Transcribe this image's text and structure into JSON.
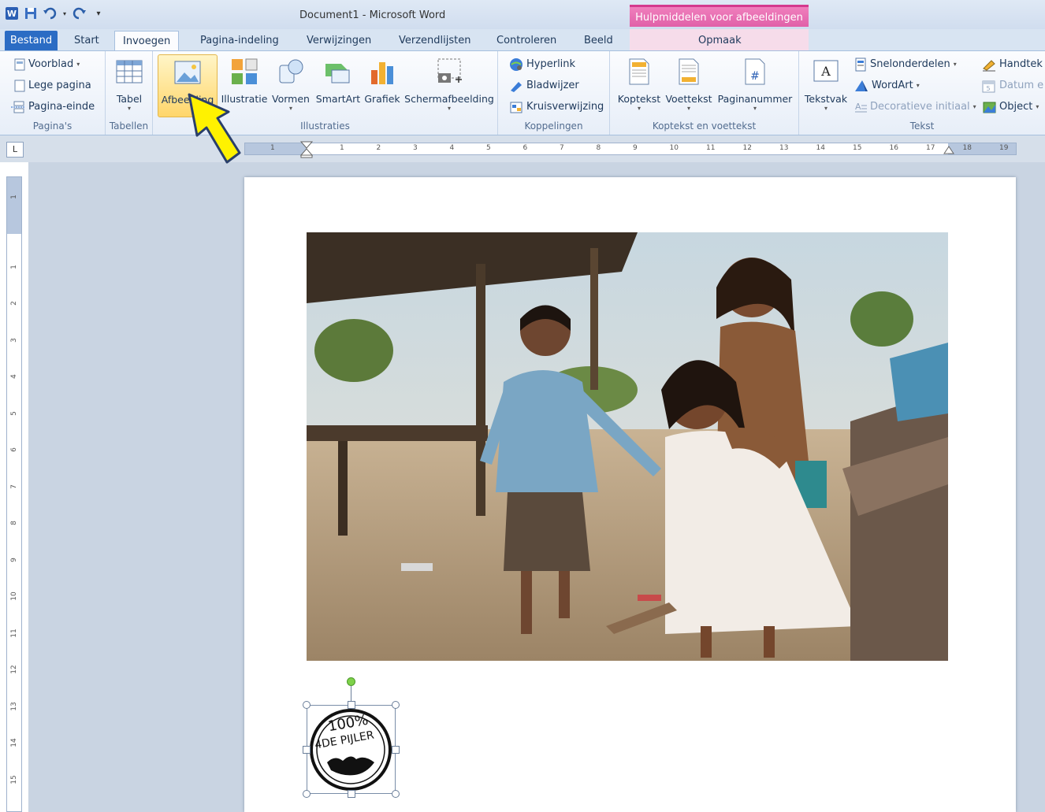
{
  "titlebar": {
    "doc_title": "Document1  -  Microsoft Word",
    "context_header": "Hulpmiddelen voor afbeeldingen"
  },
  "tabs": {
    "file": "Bestand",
    "start": "Start",
    "insert": "Invoegen",
    "page_layout": "Pagina-indeling",
    "references": "Verwijzingen",
    "mailings": "Verzendlijsten",
    "review": "Controleren",
    "view": "Beeld",
    "format": "Opmaak"
  },
  "ribbon": {
    "pages": {
      "label": "Pagina's",
      "cover": "Voorblad",
      "blank": "Lege pagina",
      "break": "Pagina-einde"
    },
    "tables": {
      "label": "Tabellen",
      "table": "Tabel"
    },
    "illustrations": {
      "label": "Illustraties",
      "picture": "Afbeelding",
      "clipart": "Illustratie",
      "shapes": "Vormen",
      "smartart": "SmartArt",
      "chart": "Grafiek",
      "screenshot": "Schermafbeelding"
    },
    "links": {
      "label": "Koppelingen",
      "hyperlink": "Hyperlink",
      "bookmark": "Bladwijzer",
      "crossref": "Kruisverwijzing"
    },
    "header_footer": {
      "label": "Koptekst en voettekst",
      "header": "Koptekst",
      "footer": "Voettekst",
      "page_number": "Paginanummer"
    },
    "text": {
      "label": "Tekst",
      "textbox": "Tekstvak",
      "quickparts": "Snelonderdelen",
      "wordart": "WordArt",
      "dropcap": "Decoratieve initiaal",
      "signature": "Handtek",
      "date": "Datum e",
      "object": "Object"
    }
  },
  "ruler": {
    "h_numbers": [
      "1",
      "1",
      "2",
      "3",
      "4",
      "5",
      "6",
      "7",
      "8",
      "9",
      "10",
      "11",
      "12",
      "13",
      "14",
      "15",
      "16",
      "17",
      "18",
      "19"
    ],
    "v_numbers": [
      "1",
      "1",
      "2",
      "3",
      "4",
      "5",
      "6",
      "7",
      "8",
      "9",
      "10",
      "11",
      "12",
      "13",
      "14",
      "15"
    ],
    "corner": "L"
  },
  "stamp": {
    "line1": "100%",
    "line2": "4DE PIJLER"
  }
}
